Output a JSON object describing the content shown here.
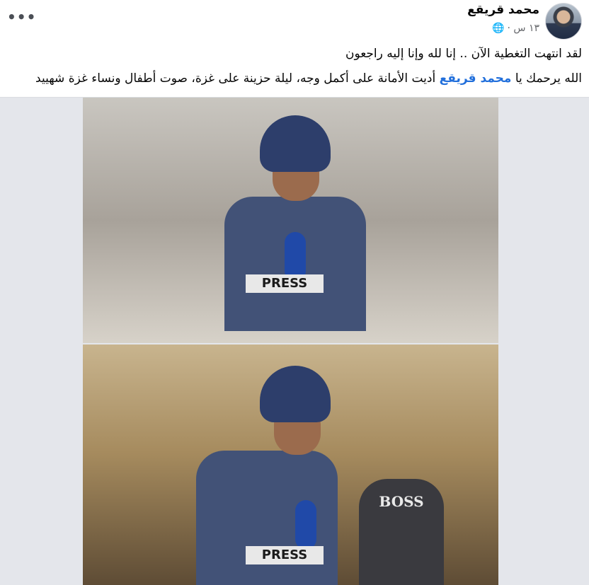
{
  "post": {
    "author": "محمد قريقع",
    "time": "١٣ س ·",
    "more_label": "•••",
    "line1": "لقد انتهت التغطية الآن .. إنا لله وإنا إليه راجعون",
    "line2_prefix": "الله يرحمك يا",
    "mention": "محمد قريقع",
    "line2_suffix": "أديت الأمانة على أكمل وجه، ليلة حزينة على غزة، صوت أطفال ونساء غزة شهييد"
  },
  "media": {
    "photo1_tag": "PRESS",
    "photo2_tag": "PRESS",
    "shirt_text": "BOSS",
    "helmet_tag": "PRESS"
  },
  "icons": {
    "more": "more-icon",
    "globe": "globe-icon"
  }
}
